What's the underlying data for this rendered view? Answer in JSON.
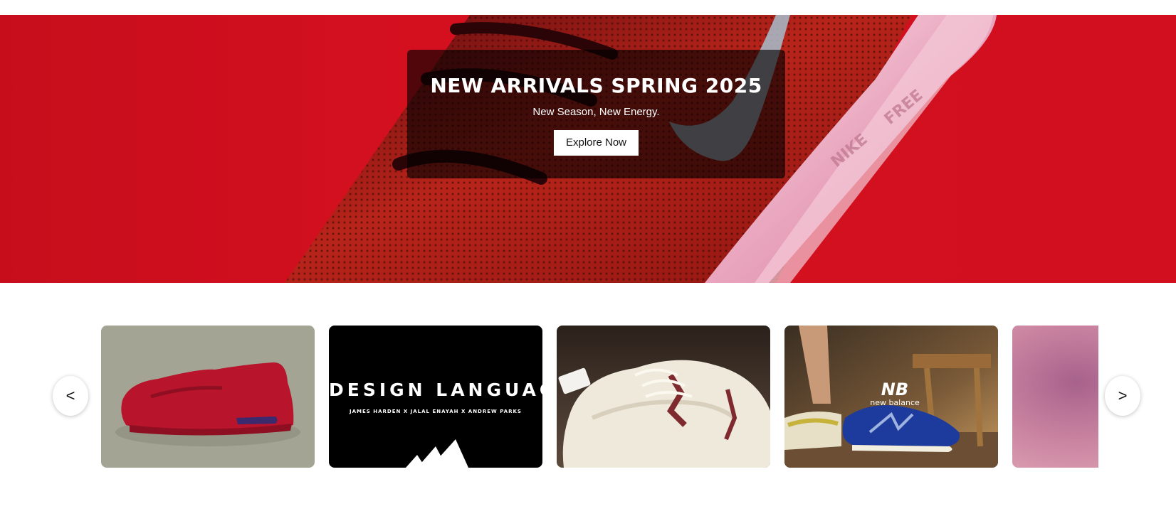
{
  "hero": {
    "title": "NEW ARRIVALS SPRING 2025",
    "subtitle": "New Season, New Energy.",
    "cta_label": "Explore Now",
    "background_color": "#d10f1e"
  },
  "carousel": {
    "prev_label": "<",
    "next_label": ">",
    "cards": [
      {
        "name": "red-sneaker-card",
        "color": "#a3a494"
      },
      {
        "name": "design-language-card",
        "color": "#000000",
        "headline": "DESIGN LANGUAGE",
        "credit": "JAMES HARDEN X JALAL ENAYAH X ANDREW PARKS"
      },
      {
        "name": "white-sneakers-card",
        "color": "#2a1f1a"
      },
      {
        "name": "new-balance-card",
        "color": "#4a3a28",
        "brand": "new balance"
      },
      {
        "name": "pink-blur-card",
        "color": "#c58aa2"
      }
    ]
  }
}
